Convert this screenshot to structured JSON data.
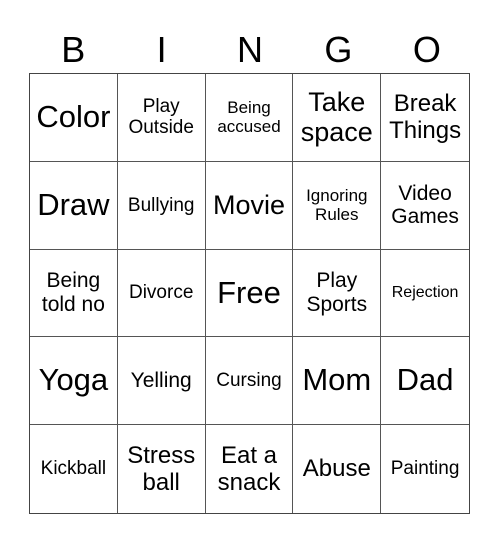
{
  "header": [
    "B",
    "I",
    "N",
    "G",
    "O"
  ],
  "cells": [
    {
      "text": "Color",
      "size": "s-xl"
    },
    {
      "text": "Play Outside",
      "size": "s-s"
    },
    {
      "text": "Being accused",
      "size": "s-xs"
    },
    {
      "text": "Take space",
      "size": "s-l"
    },
    {
      "text": "Break Things",
      "size": "s-m"
    },
    {
      "text": "Draw",
      "size": "s-xl"
    },
    {
      "text": "Bullying",
      "size": "s-s"
    },
    {
      "text": "Movie",
      "size": "s-l"
    },
    {
      "text": "Ignoring Rules",
      "size": "s-xs"
    },
    {
      "text": "Video Games",
      "size": "s-sm"
    },
    {
      "text": "Being told no",
      "size": "s-sm"
    },
    {
      "text": "Divorce",
      "size": "s-s"
    },
    {
      "text": "Free",
      "size": "s-xl"
    },
    {
      "text": "Play Sports",
      "size": "s-sm"
    },
    {
      "text": "Rejection",
      "size": "s-xxs"
    },
    {
      "text": "Yoga",
      "size": "s-xl"
    },
    {
      "text": "Yelling",
      "size": "s-sm"
    },
    {
      "text": "Cursing",
      "size": "s-s"
    },
    {
      "text": "Mom",
      "size": "s-xl"
    },
    {
      "text": "Dad",
      "size": "s-xl"
    },
    {
      "text": "Kickball",
      "size": "s-s"
    },
    {
      "text": "Stress ball",
      "size": "s-m"
    },
    {
      "text": "Eat a snack",
      "size": "s-m"
    },
    {
      "text": "Abuse",
      "size": "s-m"
    },
    {
      "text": "Painting",
      "size": "s-s"
    }
  ]
}
